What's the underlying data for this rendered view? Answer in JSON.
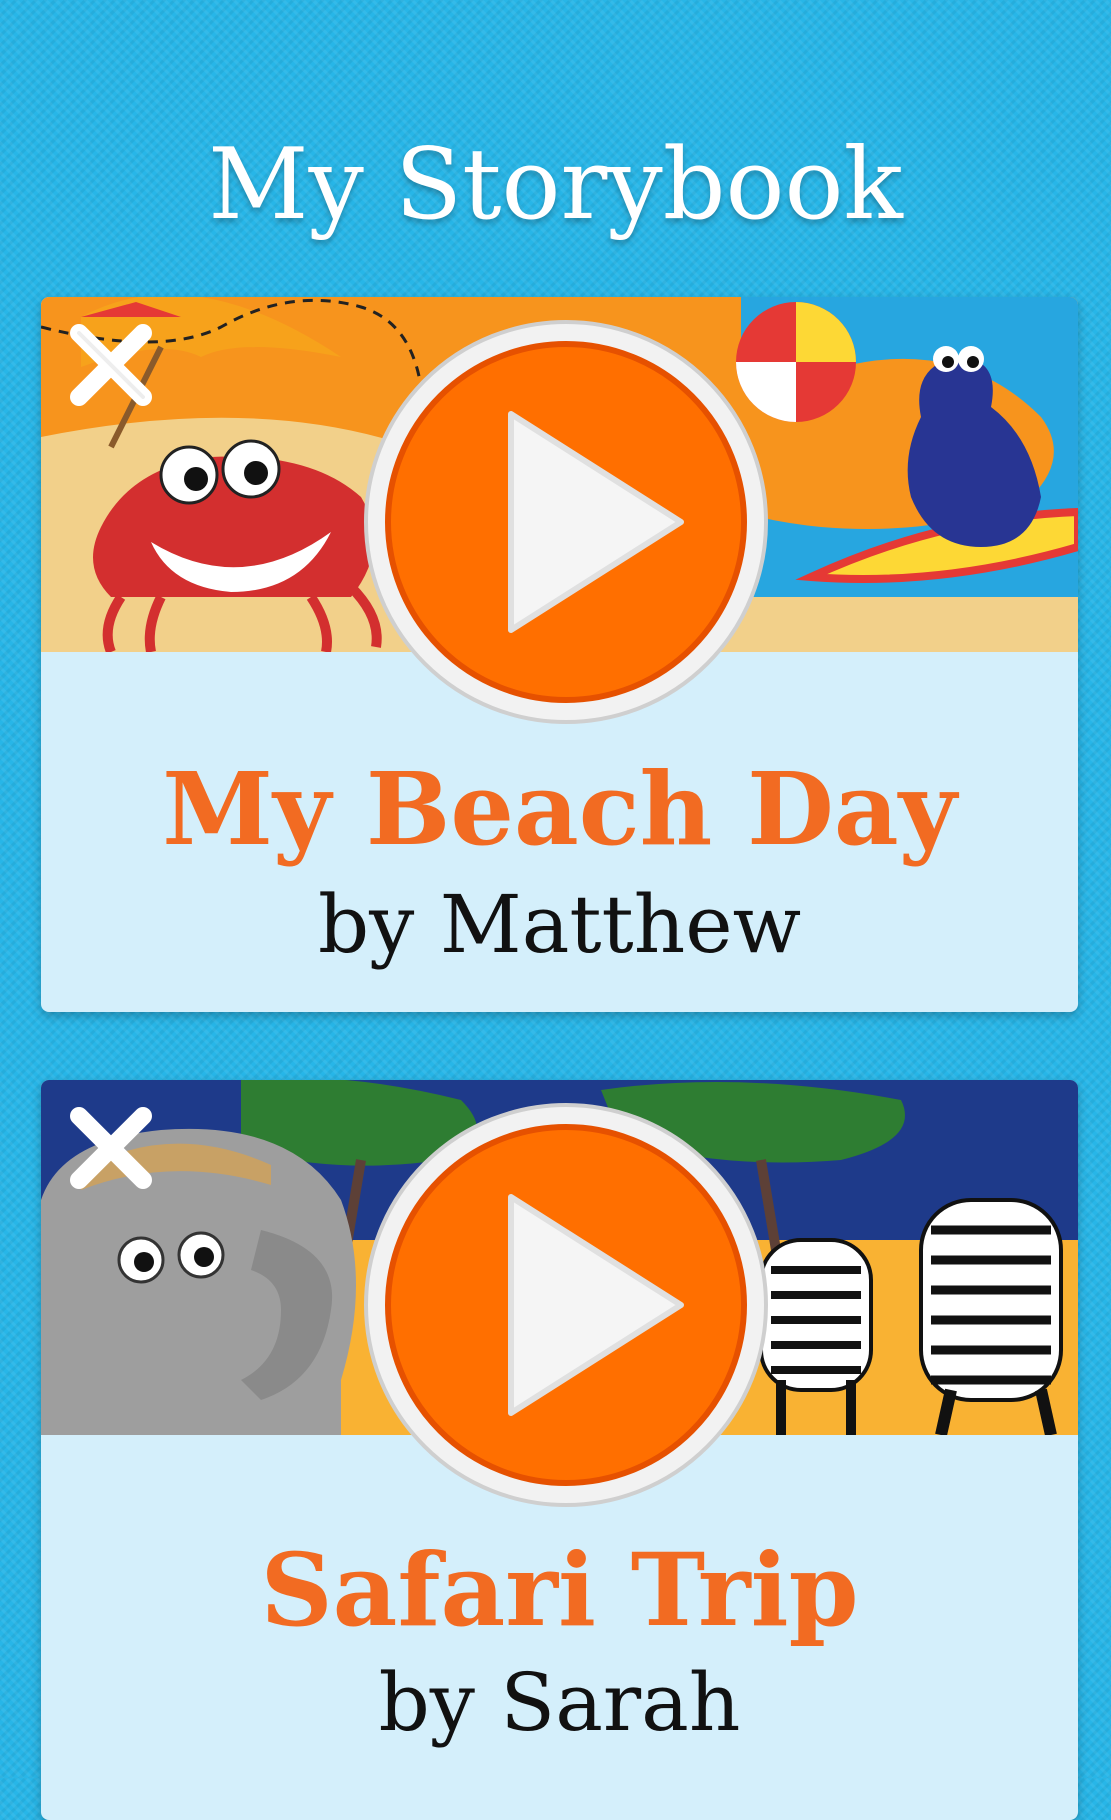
{
  "header": {
    "title": "My Storybook"
  },
  "stories": [
    {
      "title": "My Beach Day",
      "author": "by Matthew",
      "scene": "beach",
      "play_icon": "play-icon",
      "delete_icon": "close-icon"
    },
    {
      "title": "Safari Trip",
      "author": "by Sarah",
      "scene": "safari",
      "play_icon": "play-icon",
      "delete_icon": "close-icon"
    }
  ],
  "colors": {
    "background": "#27b6e8",
    "card": "#d4effb",
    "title_orange": "#f26b22",
    "play_orange": "#ff6f00"
  }
}
